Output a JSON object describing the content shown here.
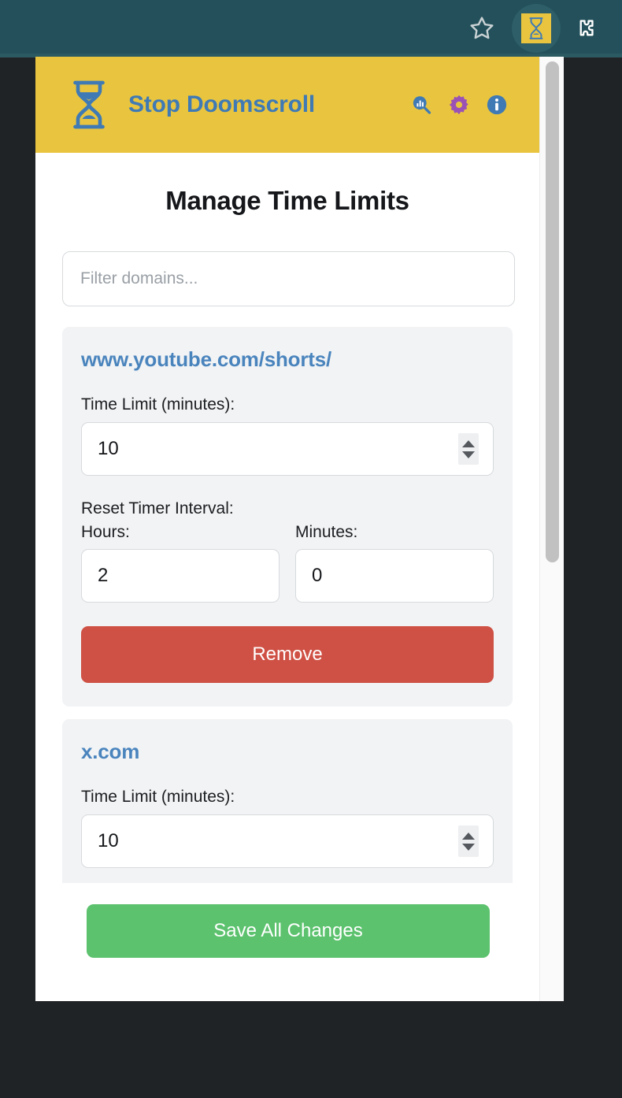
{
  "browser": {
    "bookmark_icon": "star-icon",
    "extension_icon": "hourglass-icon",
    "puzzle_icon": "puzzle-piece-icon"
  },
  "popup": {
    "header": {
      "logo_icon": "hourglass-logo-icon",
      "title": "Stop Doomscroll",
      "actions": [
        {
          "name": "stats-icon",
          "label": "Stats"
        },
        {
          "name": "gear-icon",
          "label": "Settings"
        },
        {
          "name": "info-icon",
          "label": "Info"
        }
      ]
    },
    "page_title": "Manage Time Limits",
    "filter": {
      "placeholder": "Filter domains...",
      "value": ""
    },
    "labels": {
      "time_limit": "Time Limit (minutes):",
      "reset_interval": "Reset Timer Interval:",
      "hours": "Hours:",
      "minutes": "Minutes:",
      "remove": "Remove"
    },
    "domains": [
      {
        "name": "www.youtube.com/shorts/",
        "time_limit": "10",
        "reset_hours": "2",
        "reset_minutes": "0"
      },
      {
        "name": "x.com",
        "time_limit": "10",
        "reset_hours": "",
        "reset_minutes": ""
      }
    ],
    "footer": {
      "save_label": "Save All Changes"
    }
  },
  "colors": {
    "header_yellow": "#e9c53f",
    "brand_blue": "#3f7ab5",
    "link_blue": "#4a84bd",
    "remove_red": "#cf5044",
    "save_green": "#5cc26e",
    "chrome_teal": "#23505a",
    "gear_purple": "#9a52b5"
  }
}
